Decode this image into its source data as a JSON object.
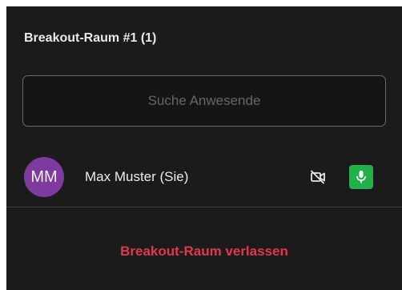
{
  "room": {
    "title": "Breakout-Raum #1 (1)"
  },
  "search": {
    "placeholder": "Suche Anwesende",
    "value": ""
  },
  "participants": [
    {
      "initials": "MM",
      "name": "Max Muster (Sie)",
      "avatar_color": "#7d3a9f",
      "camera_icon": "camera-off-icon",
      "mic_icon": "microphone-icon",
      "mic_color": "#22b04a"
    }
  ],
  "actions": {
    "leave_label": "Breakout-Raum verlassen",
    "leave_color": "#e0394f"
  },
  "theme": {
    "panel_bg": "#1b1b1b"
  }
}
